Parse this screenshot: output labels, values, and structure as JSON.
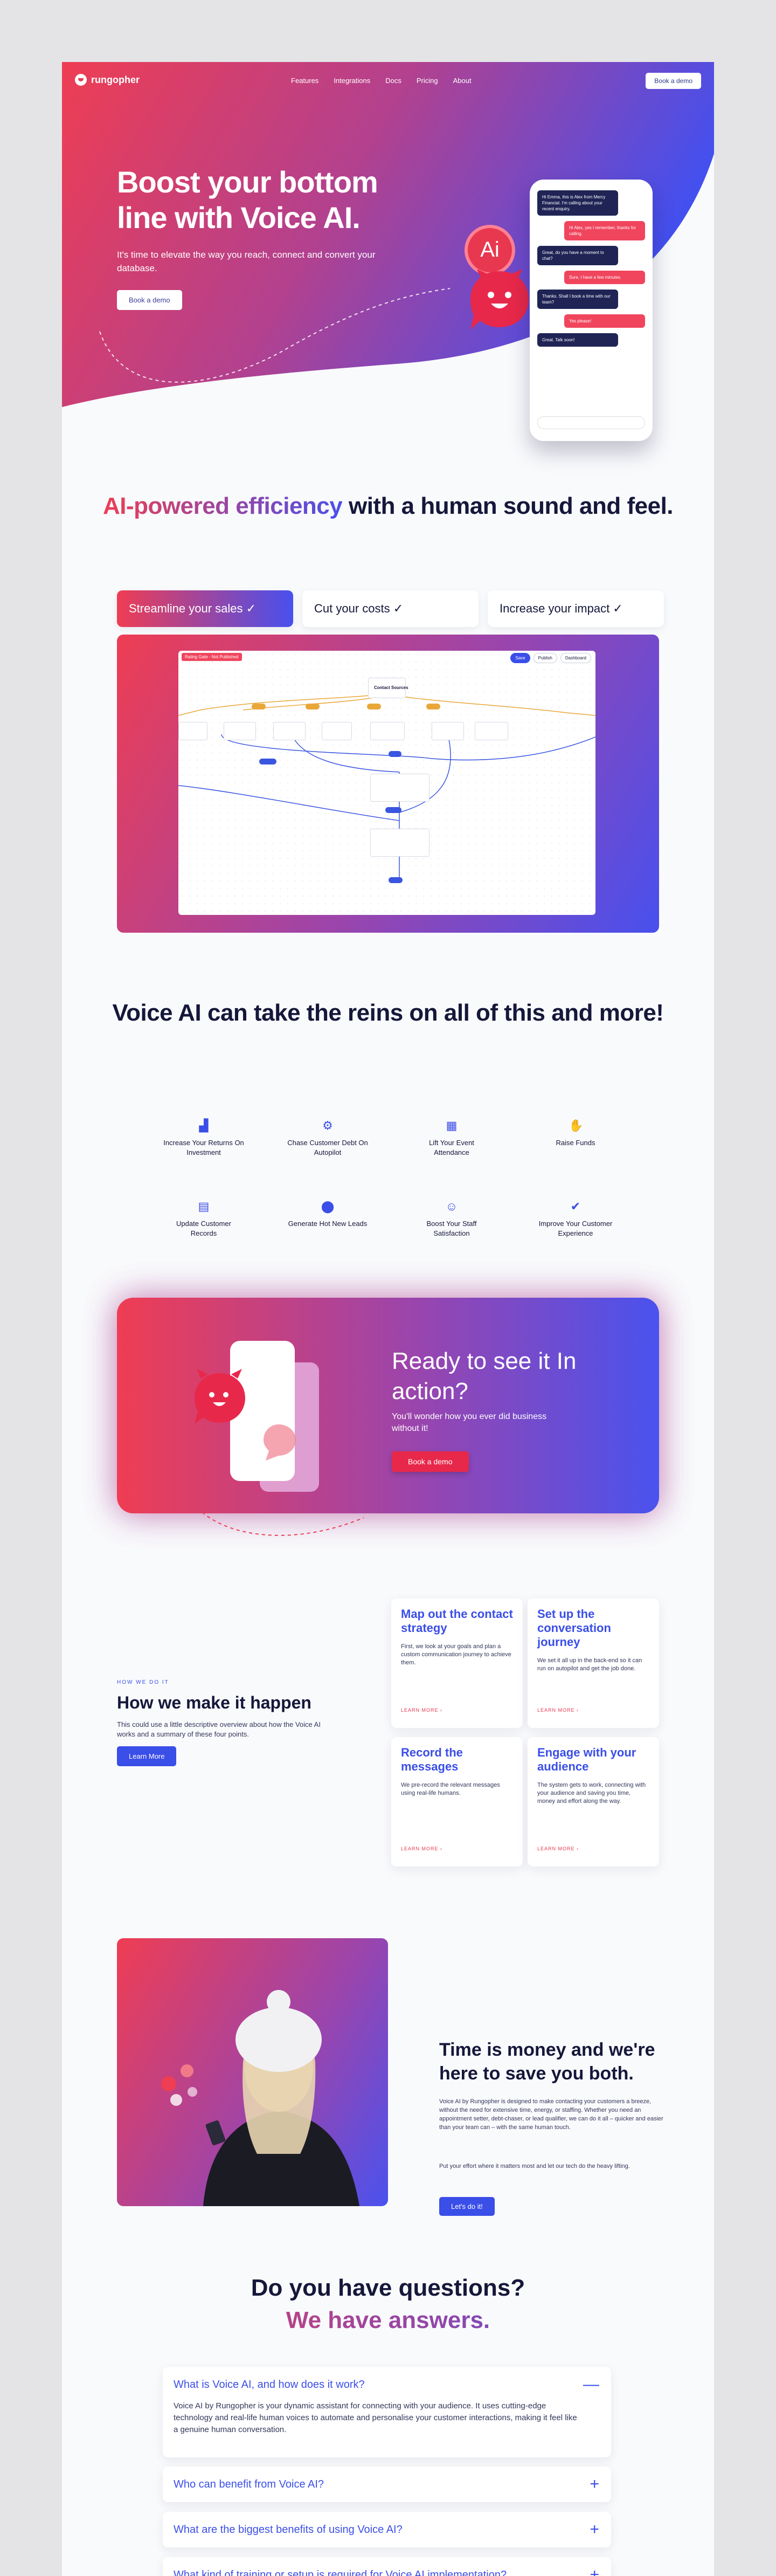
{
  "nav": {
    "brand": "rungopher",
    "links": [
      "Features",
      "Integrations",
      "Docs",
      "Pricing",
      "About"
    ],
    "demo_label": "Book a demo"
  },
  "hero": {
    "title": "Boost your bottom line with Voice AI.",
    "subtitle": "It's time to elevate the way you reach, connect and convert your database.",
    "cta_label": "Book a demo",
    "ai_badge": "Ai",
    "chat": [
      {
        "from": "bot",
        "text": "Hi Emma, this is Alex from Mercy Financial. I'm calling about your recent enquiry."
      },
      {
        "from": "user",
        "text": "Hi Alex, yes I remember, thanks for calling."
      },
      {
        "from": "bot",
        "text": "Great, do you have a moment to chat?"
      },
      {
        "from": "user",
        "text": "Sure, I have a few minutes."
      },
      {
        "from": "bot",
        "text": "Thanks. Shall I book a time with our team?"
      },
      {
        "from": "user",
        "text": "Yes please!"
      },
      {
        "from": "bot",
        "text": "Great. Talk soon!"
      }
    ]
  },
  "efficiency": {
    "title_accent": "AI-powered efficiency",
    "title_rest": " with a human sound and feel.",
    "tabs": [
      {
        "label": "Streamline your sales ✓",
        "active": true
      },
      {
        "label": "Cut your costs ✓",
        "active": false
      },
      {
        "label": "Increase your impact ✓",
        "active": false
      }
    ],
    "flow": {
      "tag": "Rating Gate - Not Published",
      "tools": [
        "Save",
        "Publish",
        "Dashboard"
      ],
      "start_node": "Contact Sources"
    }
  },
  "features": {
    "title": "Voice AI can take the reins on all of this and more!",
    "items": [
      {
        "label": "Increase Your Returns On Investment",
        "icon": "chart-icon"
      },
      {
        "label": "Chase Customer Debt On Autopilot",
        "icon": "gear-icon"
      },
      {
        "label": "Lift Your Event Attendance",
        "icon": "calendar-icon"
      },
      {
        "label": "Raise Funds",
        "icon": "hand-coin-icon"
      },
      {
        "label": "Update Customer Records",
        "icon": "document-icon"
      },
      {
        "label": "Generate Hot New Leads",
        "icon": "location-pin-icon"
      },
      {
        "label": "Boost Your Staff Satisfaction",
        "icon": "team-icon"
      },
      {
        "label": "Improve Your Customer Experience",
        "icon": "thumbs-up-icon"
      }
    ]
  },
  "cta": {
    "title": "Ready to see it In action?",
    "subtitle": "You'll wonder how you ever did business without it!",
    "button": "Book a demo"
  },
  "how": {
    "eyebrow": "HOW WE DO IT",
    "title": "How we make it happen",
    "description": "This could use a little descriptive overview about how the Voice AI works and a summary of these four points.",
    "button": "Learn More",
    "cards": [
      {
        "title": "Map out the contact strategy",
        "text": "First, we look at your goals and plan a custom communication journey to achieve them.",
        "link": "LEARN MORE ›"
      },
      {
        "title": "Set up the conversation journey",
        "text": "We set it all up in the back-end so it can run on autopilot and get the job done.",
        "link": "LEARN MORE ›"
      },
      {
        "title": "Record the messages",
        "text": "We pre-record the relevant messages using real-life humans.",
        "link": "LEARN MORE ›"
      },
      {
        "title": "Engage with your audience",
        "text": "The system gets to work, connecting with your audience and saving you time, money and effort along the way.",
        "link": "LEARN MORE ›"
      }
    ]
  },
  "time": {
    "title": "Time is money and we're here to save you both.",
    "paragraph1": "Voice AI by Rungopher is designed to make contacting your customers a breeze, without the need for extensive time, energy, or staffing. Whether you need an appointment setter, debt-chaser, or lead qualifier, we can do it all – quicker and easier than your team can – with the same human touch.",
    "paragraph2": "Put your effort where it matters most and let our tech do the heavy lifting.",
    "button": "Let's do it!"
  },
  "faq": {
    "title_line1": "Do you have questions?",
    "title_line2": "We have answers.",
    "items": [
      {
        "question": "What is Voice AI, and how does it work?",
        "answer": "Voice AI by Rungopher is your dynamic assistant for connecting with your audience. It uses cutting-edge technology and real-life human voices to automate and personalise your customer interactions, making it feel like a genuine human conversation.",
        "open": true,
        "toggle": "—"
      },
      {
        "question": "Who can benefit from Voice AI?",
        "answer": "",
        "open": false,
        "toggle": "+"
      },
      {
        "question": "What are the biggest benefits of using Voice AI?",
        "answer": "",
        "open": false,
        "toggle": "+"
      },
      {
        "question": "What kind of training or setup is required for Voice AI implementation?",
        "answer": "",
        "open": false,
        "toggle": "+"
      }
    ]
  },
  "colors": {
    "red": "#ef3d53",
    "blue": "#4850ee",
    "navy": "#15173a",
    "link_blue": "#3a4ee8"
  }
}
